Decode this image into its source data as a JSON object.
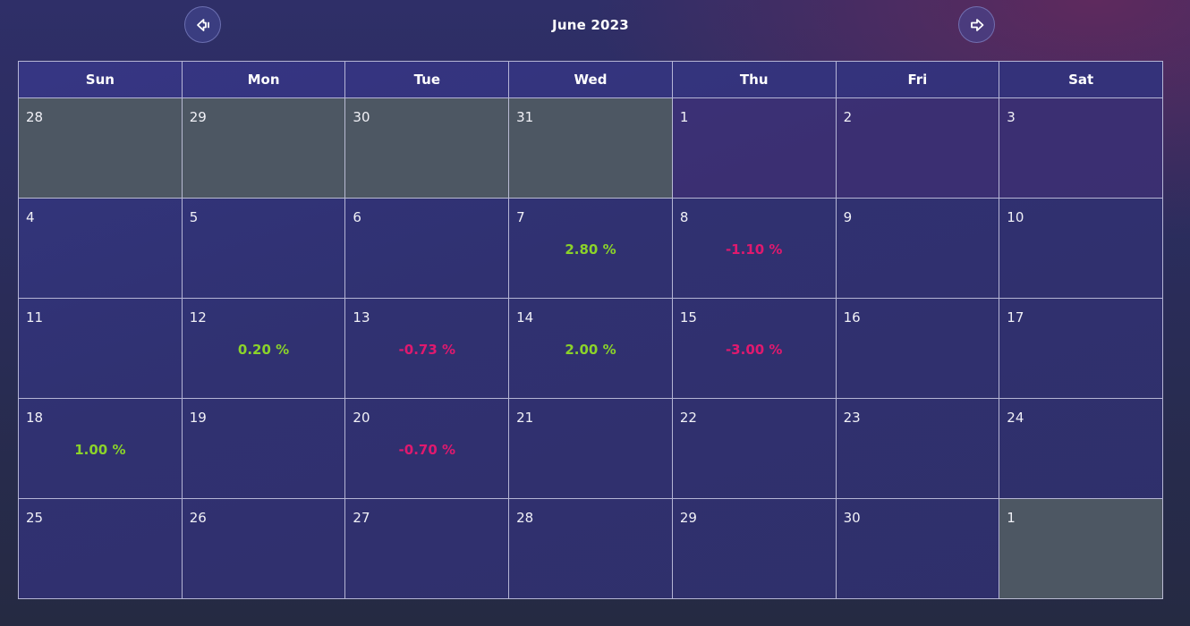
{
  "header": {
    "month_title": "June 2023"
  },
  "icons": {
    "prev": "arrow-left-icon",
    "next": "arrow-right-icon"
  },
  "colors": {
    "positive": "#8bd32a",
    "negative": "#e0196e",
    "outside_month": "#4d5763"
  },
  "weekdays": [
    "Sun",
    "Mon",
    "Tue",
    "Wed",
    "Thu",
    "Fri",
    "Sat"
  ],
  "weeks": [
    [
      {
        "day": "28",
        "outside": true
      },
      {
        "day": "29",
        "outside": true
      },
      {
        "day": "30",
        "outside": true
      },
      {
        "day": "31",
        "outside": true
      },
      {
        "day": "1"
      },
      {
        "day": "2"
      },
      {
        "day": "3"
      }
    ],
    [
      {
        "day": "4"
      },
      {
        "day": "5"
      },
      {
        "day": "6"
      },
      {
        "day": "7",
        "change": "2.80 %",
        "trend": "up"
      },
      {
        "day": "8",
        "change": "-1.10 %",
        "trend": "down"
      },
      {
        "day": "9"
      },
      {
        "day": "10"
      }
    ],
    [
      {
        "day": "11"
      },
      {
        "day": "12",
        "change": "0.20 %",
        "trend": "up"
      },
      {
        "day": "13",
        "change": "-0.73 %",
        "trend": "down"
      },
      {
        "day": "14",
        "change": "2.00 %",
        "trend": "up"
      },
      {
        "day": "15",
        "change": "-3.00 %",
        "trend": "down"
      },
      {
        "day": "16"
      },
      {
        "day": "17"
      }
    ],
    [
      {
        "day": "18",
        "change": "1.00 %",
        "trend": "up"
      },
      {
        "day": "19"
      },
      {
        "day": "20",
        "change": "-0.70 %",
        "trend": "down"
      },
      {
        "day": "21"
      },
      {
        "day": "22"
      },
      {
        "day": "23"
      },
      {
        "day": "24"
      }
    ],
    [
      {
        "day": "25"
      },
      {
        "day": "26"
      },
      {
        "day": "27"
      },
      {
        "day": "28"
      },
      {
        "day": "29"
      },
      {
        "day": "30"
      },
      {
        "day": "1",
        "outside": true
      }
    ]
  ]
}
